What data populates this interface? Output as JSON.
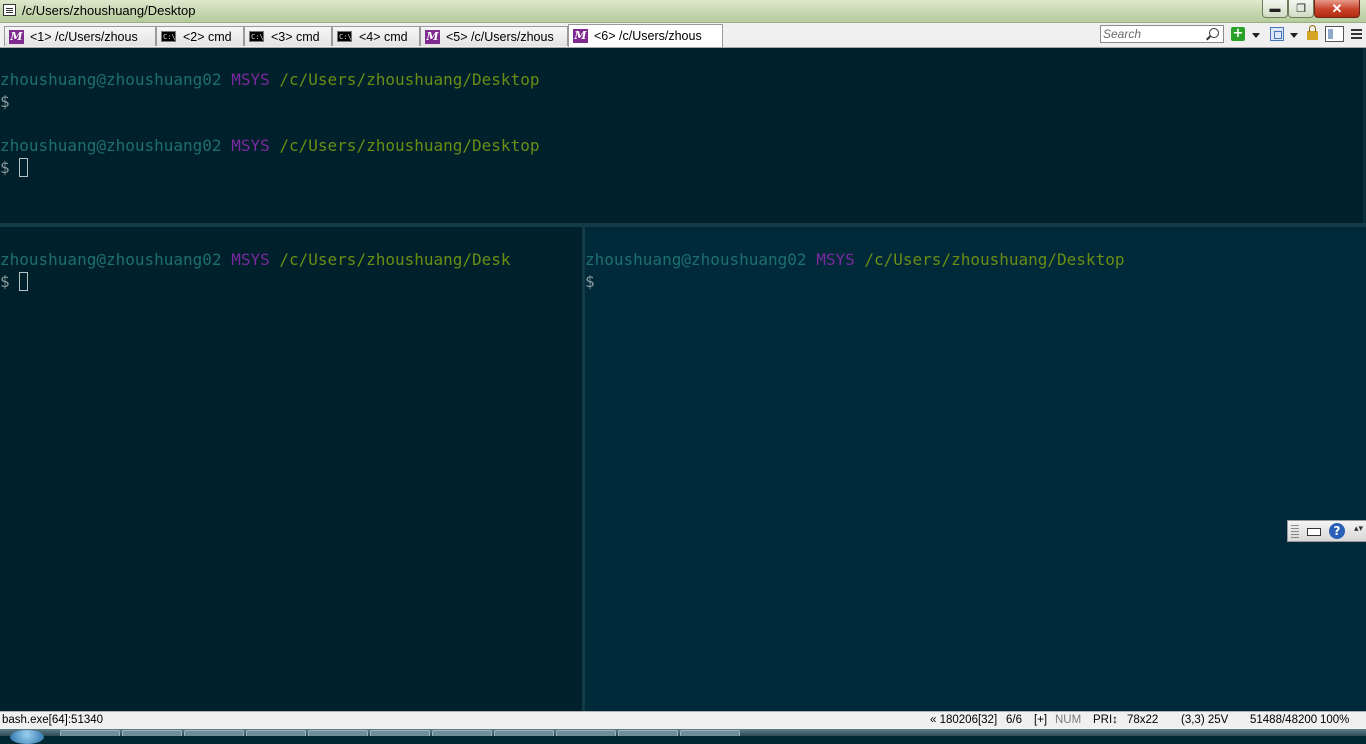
{
  "window": {
    "title": "/c/Users/zhoushuang/Desktop",
    "min_symbol": "▬",
    "max_symbol": "❐",
    "close_symbol": "✕"
  },
  "tabs": [
    {
      "label": "<1> /c/Users/zhous",
      "icon": "msys-icon",
      "active": false
    },
    {
      "label": "<2> cmd",
      "icon": "cmd-icon",
      "active": false
    },
    {
      "label": "<3> cmd",
      "icon": "cmd-icon",
      "active": false
    },
    {
      "label": "<4> cmd",
      "icon": "cmd-icon",
      "active": false
    },
    {
      "label": "<5> /c/Users/zhous",
      "icon": "msys-icon",
      "active": false
    },
    {
      "label": "<6> /c/Users/zhous",
      "icon": "msys-icon",
      "active": true
    }
  ],
  "tab_icons": {
    "msys": "M",
    "cmd": "C:\\"
  },
  "toolbar": {
    "search_placeholder": "Search",
    "new_console_symbol": "+"
  },
  "panes": {
    "top": {
      "user": "zhoushuang@zhoushuang02",
      "system": "MSYS",
      "path": "/c/Users/zhoushuang/Desktop",
      "prompt": "$"
    },
    "bottom_left": {
      "user": "zhoushuang@zhoushuang02",
      "system": "MSYS",
      "path": "/c/Users/zhoushuang/Desk",
      "prompt": "$"
    },
    "bottom_right": {
      "user": "zhoushuang@zhoushuang02",
      "system": "MSYS",
      "path": "/c/Users/zhoushuang/Desktop",
      "prompt": "$"
    }
  },
  "ime_toolbar": {
    "help_symbol": "?",
    "caret_symbol": "▴▾"
  },
  "statusbar": {
    "process": "bash.exe[64]:51340",
    "console_info": "« 180206[32]",
    "console_index": "6/6",
    "plus": "[+]",
    "num": "NUM",
    "priority": "PRI↕",
    "size": "78x22",
    "cursor": "(3,3) 25V",
    "buffer": "51488/48200",
    "zoom": "100%"
  },
  "colors": {
    "terminal_bg": "#00202b",
    "terminal_bg_alt": "#00293a",
    "user_color": "#1d6f70",
    "system_color": "#7a2a9e",
    "path_color": "#6a8d14",
    "titlebar": "#c9dab5"
  }
}
